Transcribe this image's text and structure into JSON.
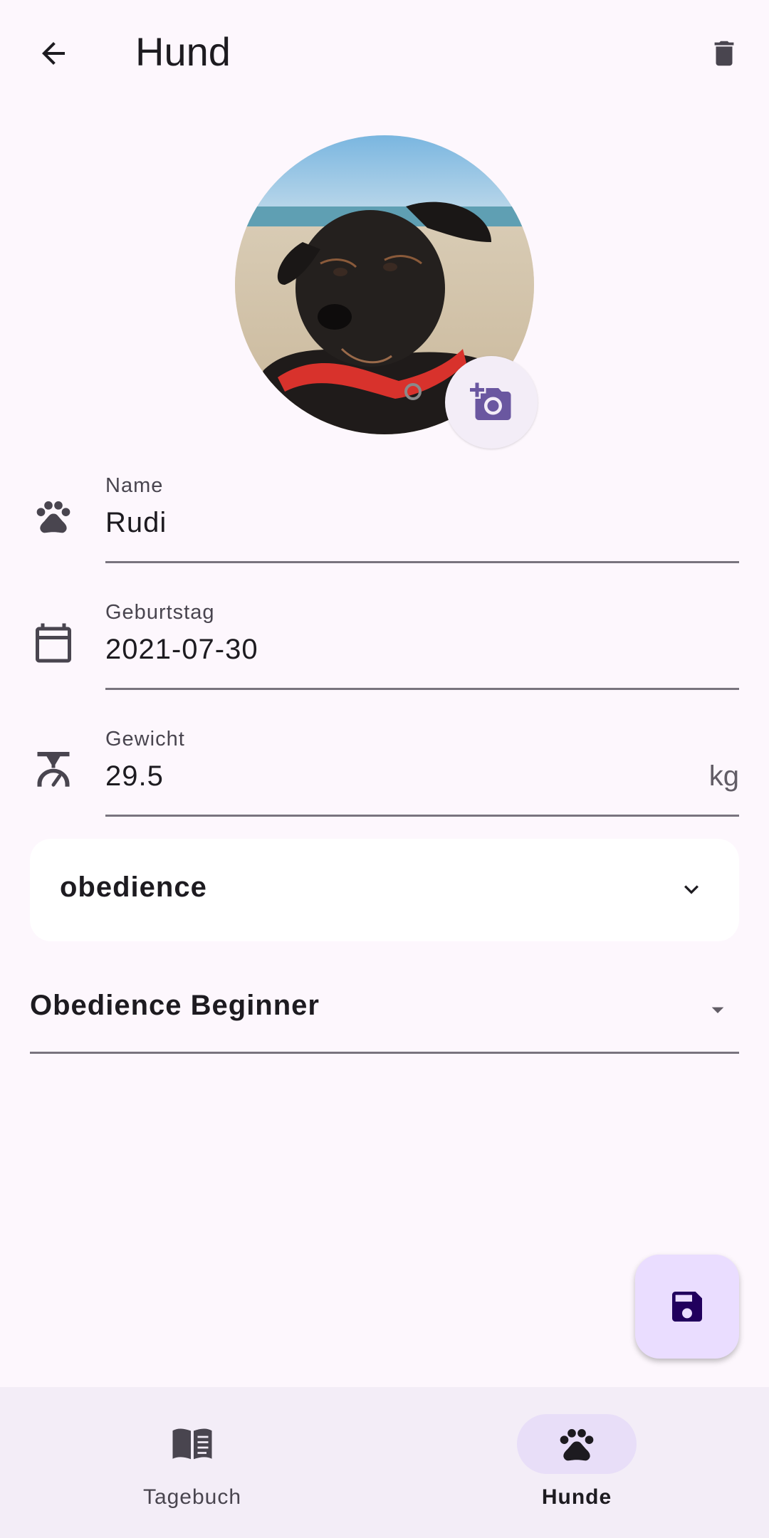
{
  "app_bar": {
    "title": "Hund"
  },
  "form": {
    "name": {
      "label": "Name",
      "value": "Rudi"
    },
    "birthday": {
      "label": "Geburtstag",
      "value": "2021-07-30"
    },
    "weight": {
      "label": "Gewicht",
      "value": "29.5",
      "suffix": "kg"
    }
  },
  "category_card": {
    "label": "obedience"
  },
  "level_dropdown": {
    "selected": "Obedience Beginner"
  },
  "nav": {
    "items": [
      {
        "label": "Tagebuch",
        "icon": "book-icon",
        "active": false
      },
      {
        "label": "Hunde",
        "icon": "paw-icon",
        "active": true
      }
    ]
  },
  "colors": {
    "background": "#fdf7fd",
    "accent": "#6750a4",
    "fab_bg": "#eaddff",
    "nav_active": "#e8def8"
  }
}
